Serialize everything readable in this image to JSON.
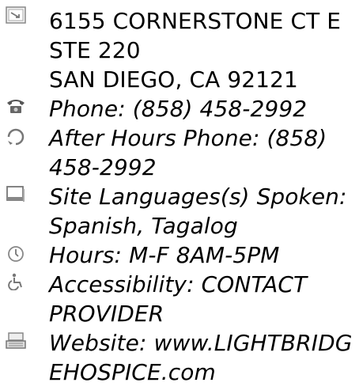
{
  "address": {
    "icon": "map-card-icon",
    "line1": "6155 CORNERSTONE CT E",
    "line2": "STE 220",
    "line3": "SAN DIEGO, CA 92121"
  },
  "phone": {
    "icon": "telephone-icon",
    "text": "Phone: (858) 458-2992"
  },
  "after_hours": {
    "icon": "after-hours-phone-icon",
    "line1": "After Hours Phone: (858)",
    "line2": "458-2992"
  },
  "languages": {
    "icon": "language-window-icon",
    "line1": "Site Languages(s) Spoken:",
    "line2": "Spanish, Tagalog"
  },
  "hours": {
    "icon": "clock-icon",
    "text": "Hours: M-F 8AM-5PM"
  },
  "accessibility": {
    "icon": "wheelchair-icon",
    "line1": "Accessibility: CONTACT",
    "line2": "PROVIDER"
  },
  "website": {
    "icon": "keyboard-computer-icon",
    "line1": "Website: www.LIGHTBRIDG",
    "line2": "EHOSPICE.com"
  }
}
